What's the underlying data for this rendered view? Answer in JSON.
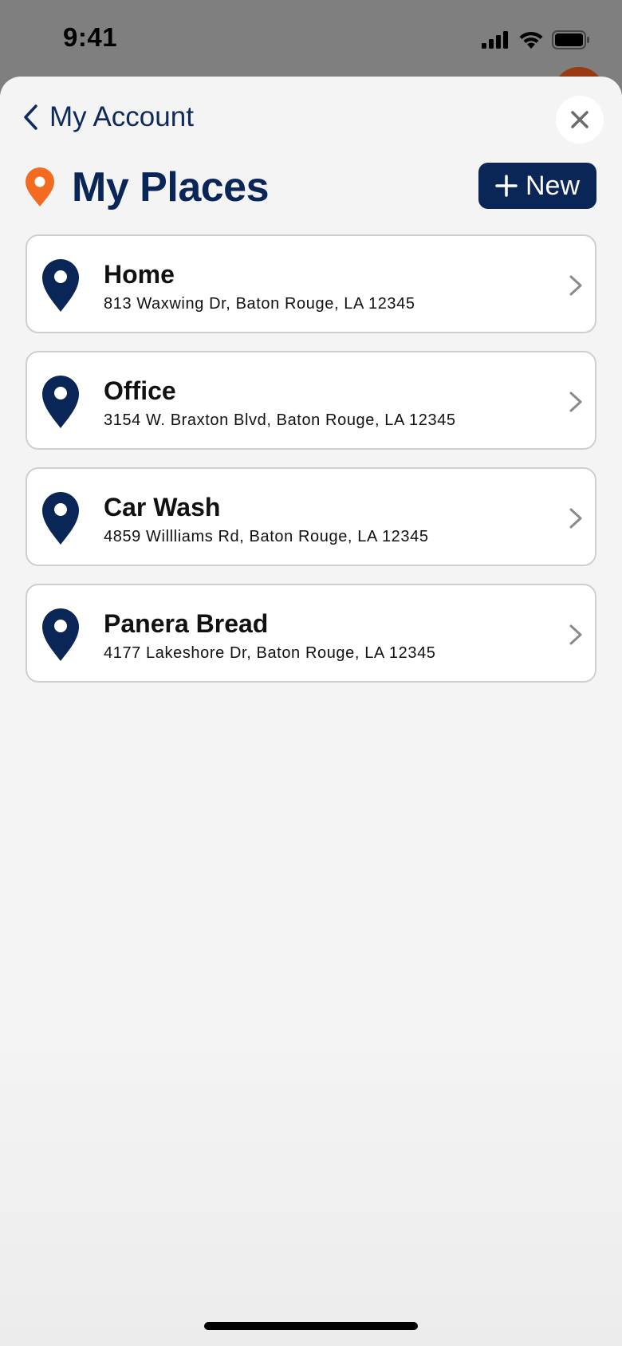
{
  "status_bar": {
    "time": "9:41",
    "icons": [
      "cellular-signal-icon",
      "wifi-icon",
      "battery-icon"
    ]
  },
  "nav": {
    "back_label": "My Account",
    "back_icon": "chevron-left-icon",
    "close_icon": "close-icon"
  },
  "header": {
    "title": "My Places",
    "title_icon": "location-pin-icon",
    "new_button_label": "New",
    "new_button_icon": "plus-icon"
  },
  "places": [
    {
      "name": "Home",
      "address": "813 Waxwing Dr, Baton Rouge, LA 12345"
    },
    {
      "name": "Office",
      "address": "3154 W. Braxton Blvd, Baton Rouge, LA 12345"
    },
    {
      "name": "Car Wash",
      "address": "4859 Willliams Rd, Baton Rouge, LA 12345"
    },
    {
      "name": "Panera Bread",
      "address": "4177 Lakeshore Dr, Baton Rouge, LA 12345"
    }
  ],
  "colors": {
    "brand_navy": "#0a2657",
    "accent_orange": "#f26b21",
    "card_border": "#cfcfcf",
    "sheet_bg": "#f4f4f4"
  }
}
